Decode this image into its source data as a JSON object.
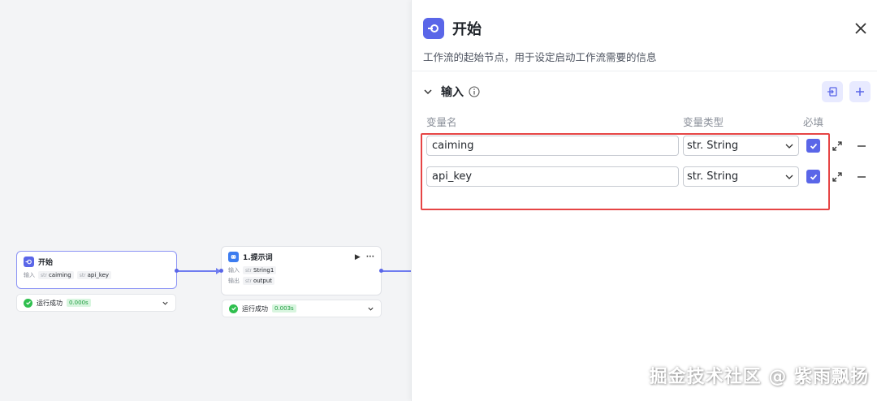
{
  "canvas": {
    "start_node": {
      "title": "开始",
      "input_label": "输入",
      "tags": [
        {
          "type": "str",
          "name": "caiming"
        },
        {
          "type": "str",
          "name": "api_key"
        }
      ],
      "status_text": "运行成功",
      "status_time": "0.000s"
    },
    "prompt_node": {
      "title": "1.提示词",
      "input_label": "输入",
      "input_tag": {
        "type": "str",
        "name": "String1"
      },
      "output_label": "输出",
      "output_tag": {
        "type": "str",
        "name": "output"
      },
      "run_icon": "play-icon",
      "more_icon": "ellipsis-icon",
      "status_text": "运行成功",
      "status_time": "0.003s"
    }
  },
  "panel": {
    "title": "开始",
    "description": "工作流的起始节点，用于设定启动工作流需要的信息",
    "section_title": "输入",
    "columns": {
      "name": "变量名",
      "type": "变量类型",
      "required": "必填"
    },
    "rows": [
      {
        "name": "caiming",
        "type": "str. String",
        "required": true
      },
      {
        "name": "api_key",
        "type": "str. String",
        "required": true
      }
    ]
  },
  "watermark": "掘金技术社区 @ 紫雨飘扬",
  "colors": {
    "accent": "#5a66e8",
    "success": "#2fbf4e",
    "highlight": "#e64545"
  }
}
